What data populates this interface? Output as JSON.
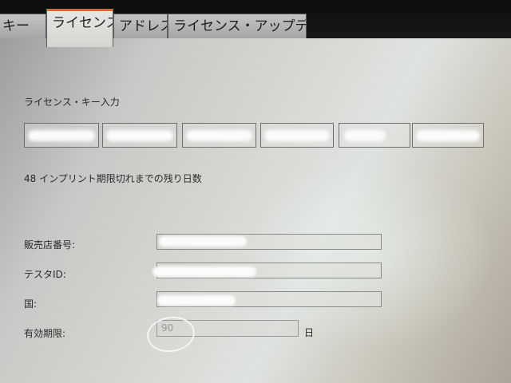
{
  "tabs": [
    {
      "label": "キー",
      "active": false
    },
    {
      "label": "ライセンス",
      "active": true
    },
    {
      "label": "アドレス",
      "active": false
    },
    {
      "label": "ライセンス・アップデート",
      "active": false
    }
  ],
  "license_section": {
    "title": "ライセンス・キー入力",
    "key_fields": [
      "",
      "",
      "",
      "",
      "",
      ""
    ]
  },
  "remaining_days_text": "48 インプリント期限切れまでの残り日数",
  "form": {
    "dealer_label": "販売店番号:",
    "dealer_value": "",
    "tester_label": "テスタID:",
    "tester_value": "",
    "country_label": "国:",
    "country_value": "",
    "validity_label": "有効期限:",
    "validity_value": "90",
    "validity_unit": "日"
  }
}
